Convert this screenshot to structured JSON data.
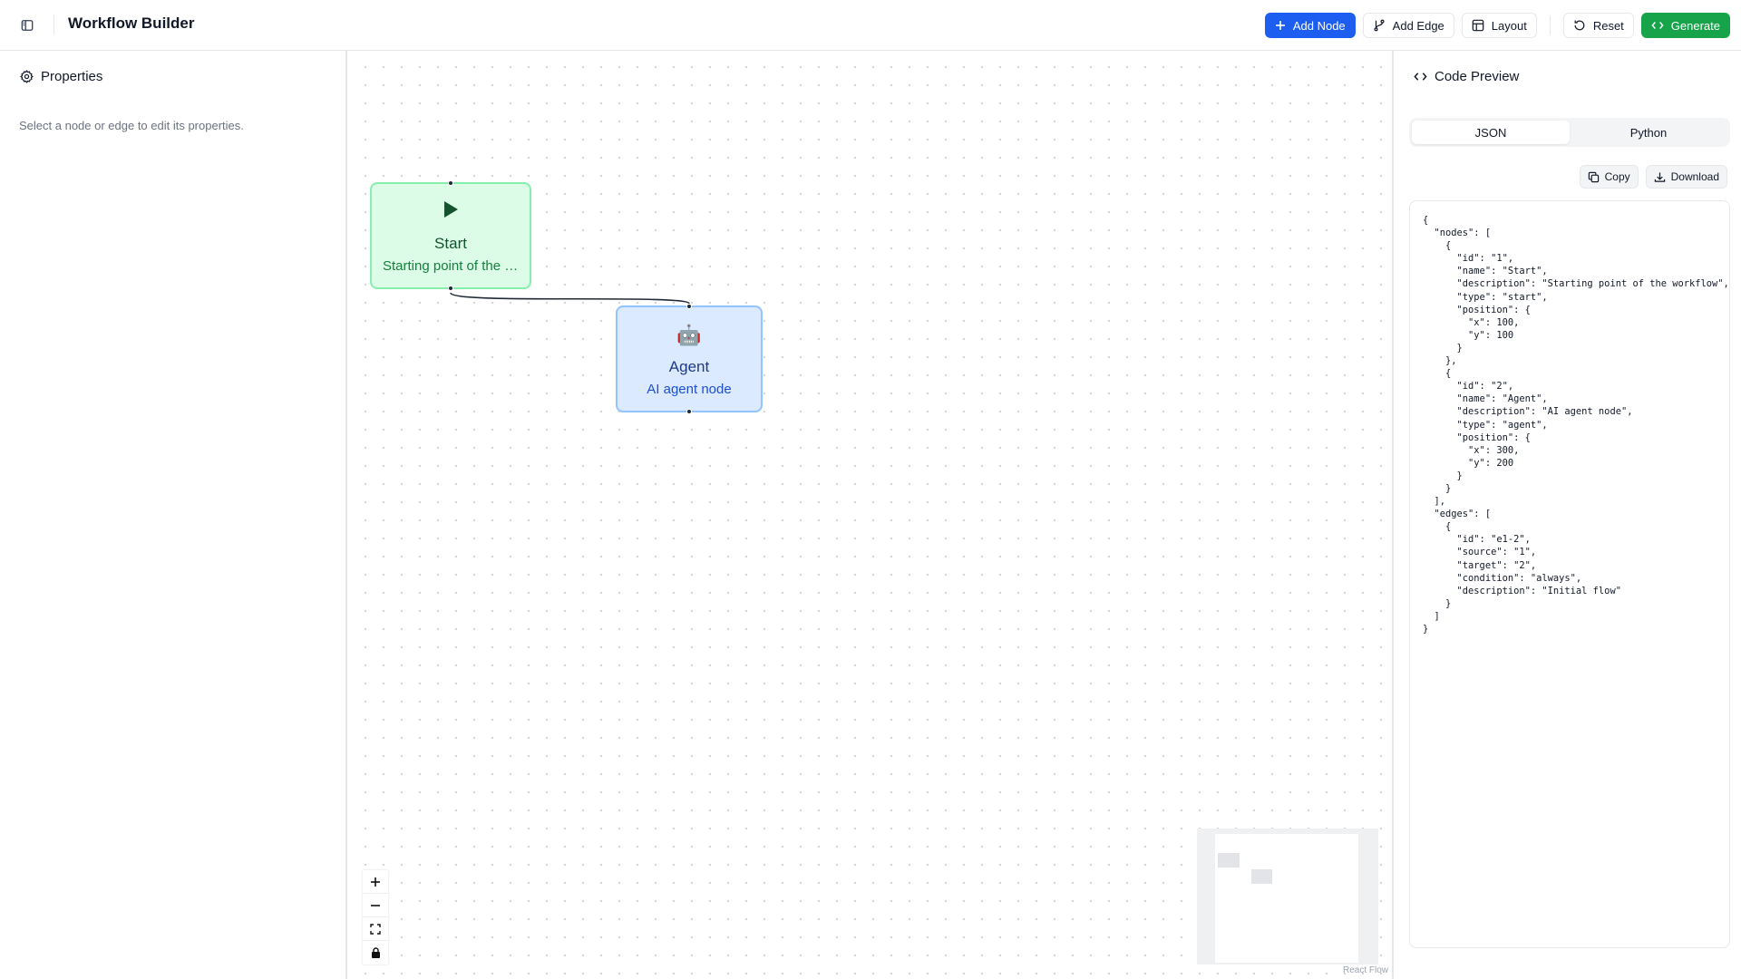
{
  "header": {
    "title": "Workflow Builder",
    "buttons": {
      "add_node": "Add Node",
      "add_edge": "Add Edge",
      "layout": "Layout",
      "reset": "Reset",
      "generate": "Generate"
    }
  },
  "properties": {
    "title": "Properties",
    "hint": "Select a node or edge to edit its properties."
  },
  "canvas": {
    "nodes": [
      {
        "name": "Start",
        "description": "Starting point of the workflow",
        "icon": "play-icon",
        "color": "#16a34a"
      },
      {
        "name": "Agent",
        "description": "AI agent node",
        "icon": "robot-icon",
        "emoji": "🤖",
        "color": "#2563eb"
      }
    ],
    "controls": [
      "zoom-in",
      "zoom-out",
      "fit-view",
      "lock"
    ],
    "attribution": "React Flow"
  },
  "code_preview": {
    "title": "Code Preview",
    "tabs": [
      {
        "label": "JSON",
        "active": true
      },
      {
        "label": "Python",
        "active": false
      }
    ],
    "copy_label": "Copy",
    "download_label": "Download",
    "code": "{\n  \"nodes\": [\n    {\n      \"id\": \"1\",\n      \"name\": \"Start\",\n      \"description\": \"Starting point of the workflow\",\n      \"type\": \"start\",\n      \"position\": {\n        \"x\": 100,\n        \"y\": 100\n      }\n    },\n    {\n      \"id\": \"2\",\n      \"name\": \"Agent\",\n      \"description\": \"AI agent node\",\n      \"type\": \"agent\",\n      \"position\": {\n        \"x\": 300,\n        \"y\": 200\n      }\n    }\n  ],\n  \"edges\": [\n    {\n      \"id\": \"e1-2\",\n      \"source\": \"1\",\n      \"target\": \"2\",\n      \"condition\": \"always\",\n      \"description\": \"Initial flow\"\n    }\n  ]\n}"
  },
  "colors": {
    "primary": "#1d5ef0",
    "success": "#16a34a",
    "start_bg": "#dcfce7",
    "agent_bg": "#dbeafe"
  }
}
